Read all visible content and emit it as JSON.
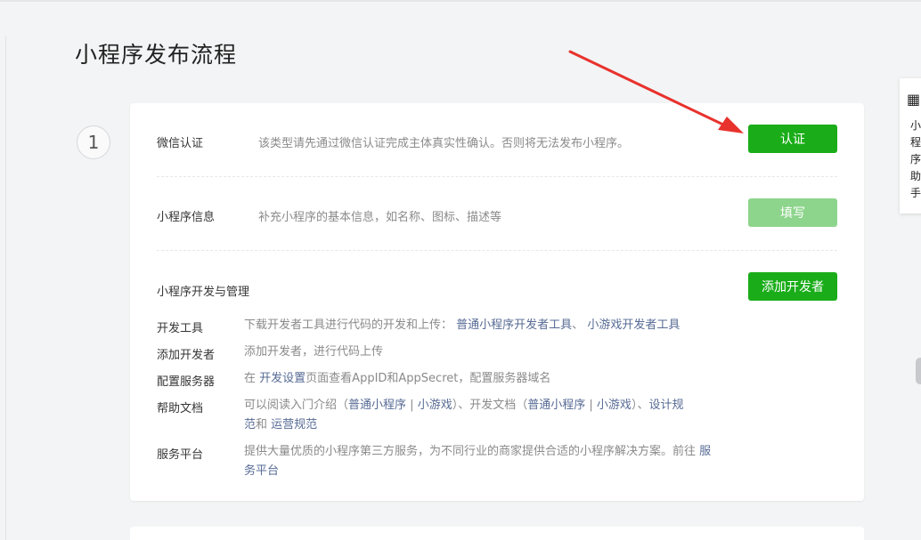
{
  "page": {
    "title": "小程序发布流程"
  },
  "step": {
    "number": "1"
  },
  "rows": {
    "wechat_auth": {
      "label": "微信认证",
      "desc": "该类型请先通过微信认证完成主体真实性确认。否则将无法发布小程序。",
      "button": "认证"
    },
    "info": {
      "label": "小程序信息",
      "desc": "补充小程序的基本信息，如名称、图标、描述等",
      "button": "填写"
    },
    "dev": {
      "label": "小程序开发与管理",
      "button": "添加开发者"
    }
  },
  "details": {
    "tools": {
      "label": "开发工具",
      "text": "下载开发者工具进行代码的开发和上传：",
      "link1": "普通小程序开发者工具",
      "sep": "、",
      "link2": "小游戏开发者工具"
    },
    "add_dev": {
      "label": "添加开发者",
      "text": "添加开发者，进行代码上传"
    },
    "server": {
      "label": "配置服务器",
      "prefix": "在",
      "link": "开发设置",
      "suffix": "页面查看AppID和AppSecret，配置服务器域名"
    },
    "help": {
      "label": "帮助文档",
      "t1": "可以阅读入门介绍（",
      "l1": "普通小程序",
      "bar1": "|",
      "l2": "小游戏",
      "t2": "）、开发文档（",
      "l3": "普通小程序",
      "bar2": "|",
      "l4": "小游戏",
      "t3": "）、",
      "l5a": "设计规",
      "l5b": "范",
      "t4": "和",
      "l6": "运营规范"
    },
    "service": {
      "label": "服务平台",
      "text": "提供大量优质的小程序第三方服务，为不同行业的商家提供合适的小程序解决方案。前往",
      "link_a": "服",
      "link_b": "务平台"
    }
  },
  "side_panel": {
    "icon": "qr-code-icon",
    "icon_glyph": "▦",
    "chars": [
      "小",
      "程",
      "序",
      "助",
      "手"
    ]
  },
  "colors": {
    "accent_green": "#1aad19",
    "disabled_green": "#8dd58c",
    "link": "#576b95",
    "annotation_arrow": "#e8322d"
  }
}
